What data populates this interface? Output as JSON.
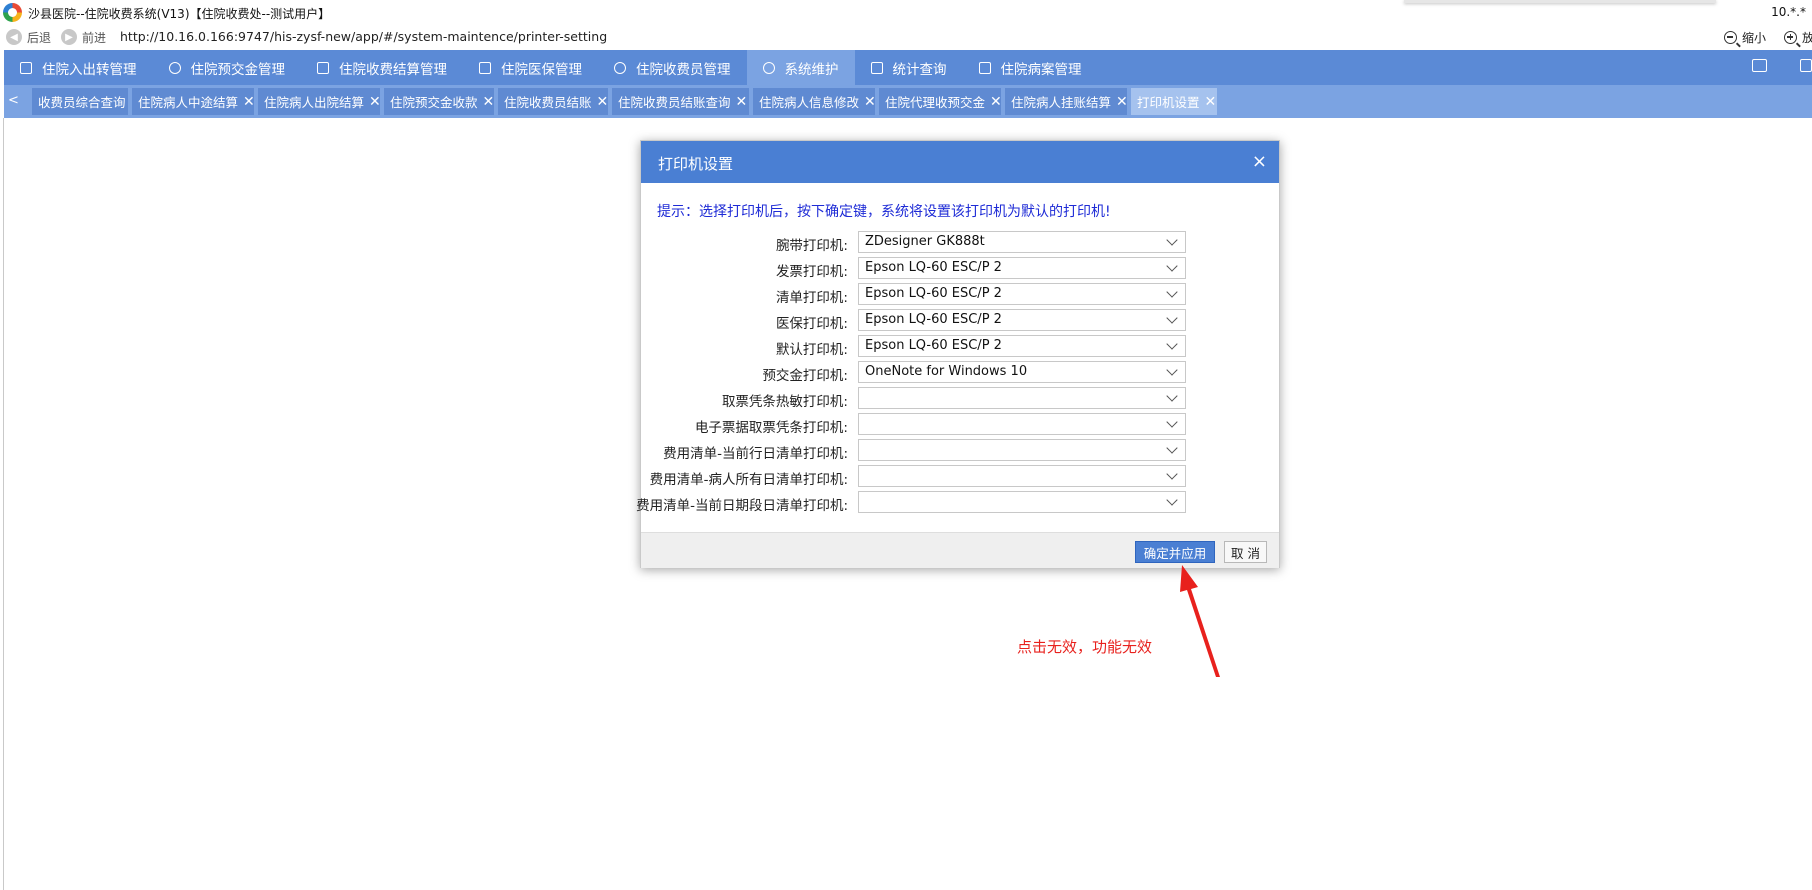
{
  "window": {
    "title": "沙县医院--住院收费系统(V13)【住院收费处--测试用户】",
    "right_text": "10.*.*"
  },
  "addressbar": {
    "back_label": "后退",
    "forward_label": "前进",
    "url": "http://10.16.0.166:9747/his-zysf-new/app/#/system-maintence/printer-setting",
    "zoom_out_label": "缩小",
    "zoom_in_label": "放"
  },
  "main_menu": {
    "items": [
      {
        "label": "住院入出转管理",
        "icon": "building-icon"
      },
      {
        "label": "住院预交金管理",
        "icon": "coin-icon"
      },
      {
        "label": "住院收费结算管理",
        "icon": "document-icon"
      },
      {
        "label": "住院医保管理",
        "icon": "card-icon"
      },
      {
        "label": "住院收费员管理",
        "icon": "user-icon"
      },
      {
        "label": "系统维护",
        "icon": "gear-icon"
      },
      {
        "label": "统计查询",
        "icon": "chart-icon"
      },
      {
        "label": "住院病案管理",
        "icon": "book-icon"
      }
    ],
    "active_index": 5
  },
  "tabs": {
    "items": [
      {
        "label": "收费员综合查询",
        "closable": false
      },
      {
        "label": "住院病人中途结算",
        "closable": true
      },
      {
        "label": "住院病人出院结算",
        "closable": true
      },
      {
        "label": "住院预交金收款",
        "closable": true
      },
      {
        "label": "住院收费员结账",
        "closable": true
      },
      {
        "label": "住院收费员结账查询",
        "closable": true
      },
      {
        "label": "住院病人信息修改",
        "closable": true
      },
      {
        "label": "住院代理收预交金",
        "closable": true
      },
      {
        "label": "住院病人挂账结算",
        "closable": true
      },
      {
        "label": "打印机设置",
        "closable": true
      }
    ],
    "active_index": 9,
    "close_glyph": "✕",
    "prev_glyph": "<"
  },
  "dialog": {
    "title": "打印机设置",
    "close_glyph": "×",
    "hint": "提示：选择打印机后，按下确定键，系统将设置该打印机为默认的打印机!",
    "rows": [
      {
        "label": "腕带打印机:",
        "value": "ZDesigner GK888t"
      },
      {
        "label": "发票打印机:",
        "value": "Epson LQ-60 ESC/P 2"
      },
      {
        "label": "清单打印机:",
        "value": "Epson LQ-60 ESC/P 2"
      },
      {
        "label": "医保打印机:",
        "value": "Epson LQ-60 ESC/P 2"
      },
      {
        "label": "默认打印机:",
        "value": "Epson LQ-60 ESC/P 2"
      },
      {
        "label": "预交金打印机:",
        "value": "OneNote for Windows 10"
      },
      {
        "label": "取票凭条热敏打印机:",
        "value": ""
      },
      {
        "label": "电子票据取票凭条打印机:",
        "value": ""
      },
      {
        "label": "费用清单-当前行日清单打印机:",
        "value": ""
      },
      {
        "label": "费用清单-病人所有日清单打印机:",
        "value": ""
      },
      {
        "label": "费用清单-当前日期段日清单打印机:",
        "value": ""
      }
    ],
    "ok_label": "确定并应用",
    "cancel_label": "取 消"
  },
  "annotation": {
    "text": "点击无效，功能无效",
    "color": "#e8211d"
  },
  "colors": {
    "menu_bg": "#5b8ad6",
    "tabbar_bg": "#7ba3e2",
    "dialog_header": "#4a7fd3",
    "hint_text": "#1e2bd6"
  }
}
